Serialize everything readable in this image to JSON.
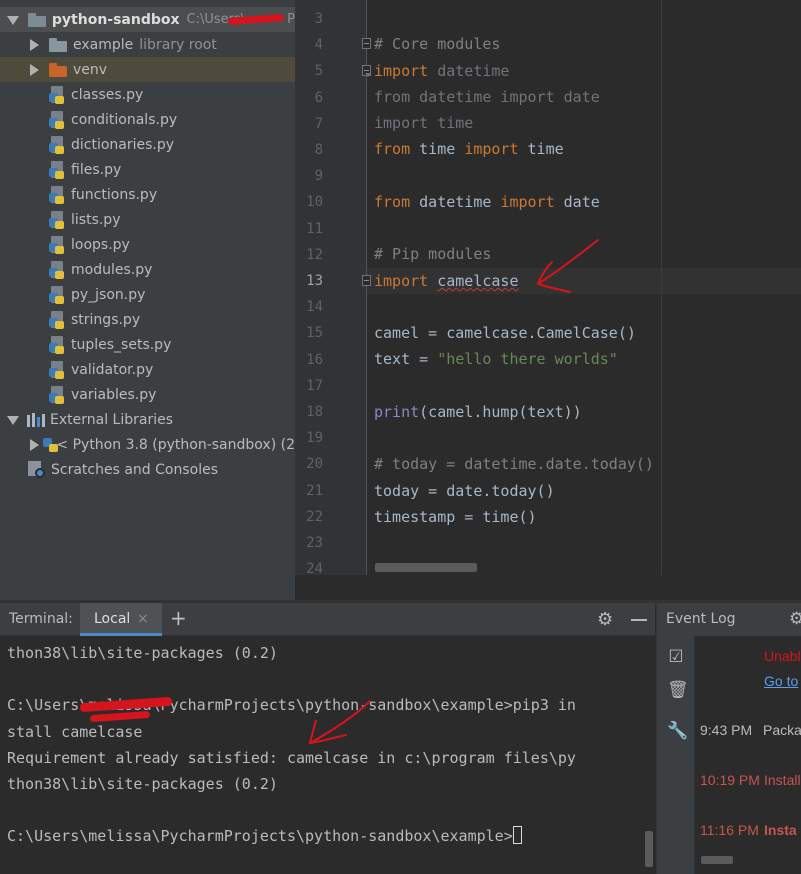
{
  "colors": {
    "background": "#2b2b2b",
    "panel": "#3c3f41",
    "keyword": "#cc7832",
    "comment": "#808080",
    "string": "#6a8759",
    "error_red": "#bc3f3c",
    "annotation_red": "#d7141d",
    "folder": "#9aa7b0",
    "venv_folder": "#c7642a"
  },
  "project_tree": {
    "root": {
      "name": "python-sandbox",
      "path": "C:\\Users\\",
      "path_suffix": "P"
    },
    "folders": [
      {
        "name": "example",
        "note": "library root"
      },
      {
        "name": "venv"
      }
    ],
    "files": [
      "classes.py",
      "conditionals.py",
      "dictionaries.py",
      "files.py",
      "functions.py",
      "lists.py",
      "loops.py",
      "modules.py",
      "py_json.py",
      "strings.py",
      "tuples_sets.py",
      "validator.py",
      "variables.py"
    ],
    "external_libraries": "External Libraries",
    "python_sdk": "< Python 3.8 (python-sandbox) (2",
    "scratches": "Scratches and Consoles"
  },
  "editor": {
    "line_numbers": [
      "3",
      "4",
      "5",
      "6",
      "7",
      "8",
      "9",
      "10",
      "11",
      "12",
      "13",
      "14",
      "15",
      "16",
      "17",
      "18",
      "19",
      "20",
      "21",
      "22",
      "23",
      "24"
    ],
    "current_line": "13",
    "code": {
      "l4": "# Core modules",
      "l5_kw": "import",
      "l5_mod": " datetime",
      "l6": "from datetime import date",
      "l7": "import time",
      "l8_kw1": "from",
      "l8_mod": " time ",
      "l8_kw2": "import",
      "l8_name": " time",
      "l10_kw1": "from",
      "l10_mod": " datetime ",
      "l10_kw2": "import",
      "l10_name": " date",
      "l12": "# Pip modules",
      "l13_kw": "import",
      "l13_mod": "camelcase",
      "l15": "camel = camelcase.CamelCase()",
      "l16_lhs": "text = ",
      "l16_str": "\"hello there worlds\"",
      "l18_fn": "print",
      "l18_rest": "(camel.hump(text))",
      "l20": "# today = datetime.date.today()",
      "l21": "today = date.today()",
      "l22": "timestamp = time()"
    }
  },
  "terminal": {
    "title": "Terminal:",
    "tab_label": "Local",
    "tab_close": "×",
    "add": "+",
    "lines": [
      "thon38\\lib\\site-packages (0.2)",
      "",
      "C:\\Users\\melissa\\PycharmProjects\\python-sandbox\\example>pip3 in",
      "stall camelcase",
      "Requirement already satisfied: camelcase in c:\\program files\\py",
      "thon38\\lib\\site-packages (0.2)",
      "",
      "C:\\Users\\melissa\\PycharmProjects\\python-sandbox\\example>"
    ]
  },
  "event_log": {
    "title": "Event Log",
    "entries": [
      {
        "text": "Unabl",
        "color": "#d7141d"
      },
      {
        "text": "Go to",
        "color": "#589df6",
        "link": true
      },
      {
        "time": "9:43 PM",
        "text": "Packa",
        "color": "#bbbbbb"
      },
      {
        "time": "10:19 PM",
        "text": "Install",
        "color": "#c75450"
      },
      {
        "time": "11:16 PM",
        "text": "Insta",
        "color": "#c75450",
        "bold": true
      }
    ]
  }
}
